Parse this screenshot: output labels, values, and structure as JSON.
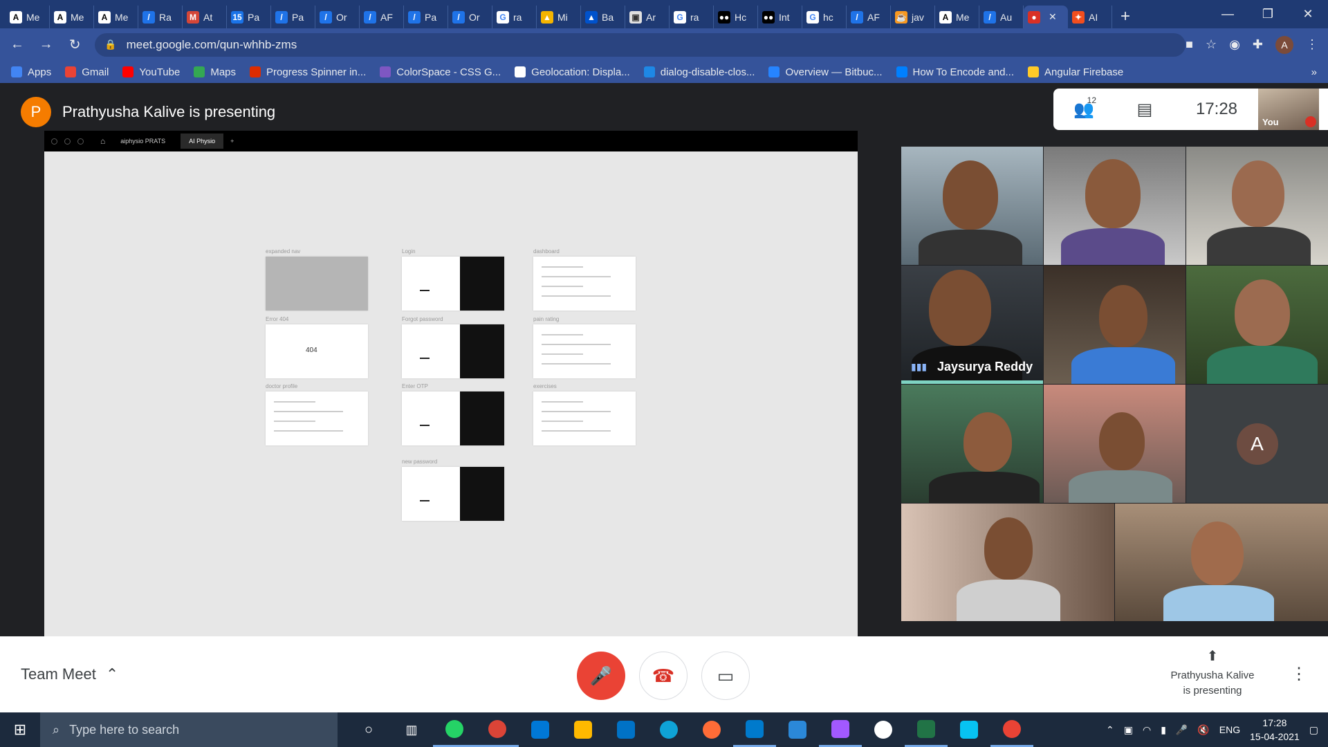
{
  "browser": {
    "tabs": [
      {
        "label": "Me",
        "fav": "A",
        "color": "#ffffff",
        "fg": "#000"
      },
      {
        "label": "Me",
        "fav": "A",
        "color": "#ffffff",
        "fg": "#000"
      },
      {
        "label": "Me",
        "fav": "A",
        "color": "#ffffff",
        "fg": "#000"
      },
      {
        "label": "Ra",
        "fav": "/",
        "color": "#1f73e8",
        "fg": "#fff"
      },
      {
        "label": "At",
        "fav": "M",
        "color": "#d44638",
        "fg": "#fff"
      },
      {
        "label": "Pa",
        "fav": "15",
        "color": "#1a73e8",
        "fg": "#fff"
      },
      {
        "label": "Pa",
        "fav": "/",
        "color": "#1f73e8",
        "fg": "#fff"
      },
      {
        "label": "Or",
        "fav": "/",
        "color": "#1f73e8",
        "fg": "#fff"
      },
      {
        "label": "AF",
        "fav": "/",
        "color": "#1f73e8",
        "fg": "#fff"
      },
      {
        "label": "Pa",
        "fav": "/",
        "color": "#1f73e8",
        "fg": "#fff"
      },
      {
        "label": "Or",
        "fav": "/",
        "color": "#1f73e8",
        "fg": "#fff"
      },
      {
        "label": "ra",
        "fav": "G",
        "color": "#ffffff",
        "fg": "#4285f4"
      },
      {
        "label": "Mi",
        "fav": "▲",
        "color": "#f4b400",
        "fg": "#fff"
      },
      {
        "label": "Ba",
        "fav": "▲",
        "color": "#0052cc",
        "fg": "#fff"
      },
      {
        "label": "Ar",
        "fav": "▣",
        "color": "#e0e0e0",
        "fg": "#333"
      },
      {
        "label": "ra",
        "fav": "G",
        "color": "#ffffff",
        "fg": "#4285f4"
      },
      {
        "label": "Hc",
        "fav": "●●",
        "color": "#000000",
        "fg": "#fff"
      },
      {
        "label": "Int",
        "fav": "●●",
        "color": "#000000",
        "fg": "#fff"
      },
      {
        "label": "hc",
        "fav": "G",
        "color": "#ffffff",
        "fg": "#4285f4"
      },
      {
        "label": "AF",
        "fav": "/",
        "color": "#1f73e8",
        "fg": "#fff"
      },
      {
        "label": "jav",
        "fav": "☕",
        "color": "#f89820",
        "fg": "#fff"
      },
      {
        "label": "Me",
        "fav": "A",
        "color": "#ffffff",
        "fg": "#000"
      },
      {
        "label": "Au",
        "fav": "/",
        "color": "#1f73e8",
        "fg": "#fff"
      },
      {
        "label": "",
        "fav": "●",
        "color": "#d93025",
        "fg": "#fff",
        "active": true
      },
      {
        "label": "AI",
        "fav": "✦",
        "color": "#f24e1e",
        "fg": "#fff"
      }
    ],
    "url": "meet.google.com/qun-whhb-zms",
    "bookmarks": [
      {
        "label": "Apps",
        "color": "#4285f4"
      },
      {
        "label": "Gmail",
        "color": "#ea4335"
      },
      {
        "label": "YouTube",
        "color": "#ff0000"
      },
      {
        "label": "Maps",
        "color": "#34a853"
      },
      {
        "label": "Progress Spinner in...",
        "color": "#dd2c00"
      },
      {
        "label": "ColorSpace - CSS G...",
        "color": "#7e57c2"
      },
      {
        "label": "Geolocation: Displa...",
        "color": "#ffffff"
      },
      {
        "label": "dialog-disable-clos...",
        "color": "#1e88e5"
      },
      {
        "label": "Overview — Bitbuc...",
        "color": "#2684ff"
      },
      {
        "label": "How To Encode and...",
        "color": "#0080ff"
      },
      {
        "label": "Angular Firebase",
        "color": "#ffca28"
      }
    ],
    "avatar_letter": "A"
  },
  "meet": {
    "presenter_initial": "P",
    "presenter_text": "Prathyusha Kalive is presenting",
    "participant_count": "12",
    "time": "17:28",
    "self_label": "You",
    "meeting_name": "Team Meet",
    "presenting_caption_line1": "Prathyusha Kalive",
    "presenting_caption_line2": "is presenting",
    "active_speaker": "Jaysurya Reddy",
    "placeholder_initial": "A"
  },
  "shared_screen": {
    "tabs": [
      "aiphysio PRATS",
      "AI Physio"
    ],
    "frames": [
      {
        "label": "expanded nav",
        "kind": "gray"
      },
      {
        "label": "Login",
        "kind": "split"
      },
      {
        "label": "dashboard",
        "kind": "light"
      },
      {
        "label": "Error 404",
        "kind": "error",
        "text": "404"
      },
      {
        "label": "Forgot password",
        "kind": "split"
      },
      {
        "label": "pain rating",
        "kind": "light"
      },
      {
        "label": "doctor profile",
        "kind": "light"
      },
      {
        "label": "Enter OTP",
        "kind": "split"
      },
      {
        "label": "exercises",
        "kind": "light"
      },
      {
        "label": "new password",
        "kind": "split"
      }
    ]
  },
  "taskbar": {
    "search_placeholder": "Type here to search",
    "lang": "ENG",
    "time": "17:28",
    "date": "15-04-2021"
  }
}
